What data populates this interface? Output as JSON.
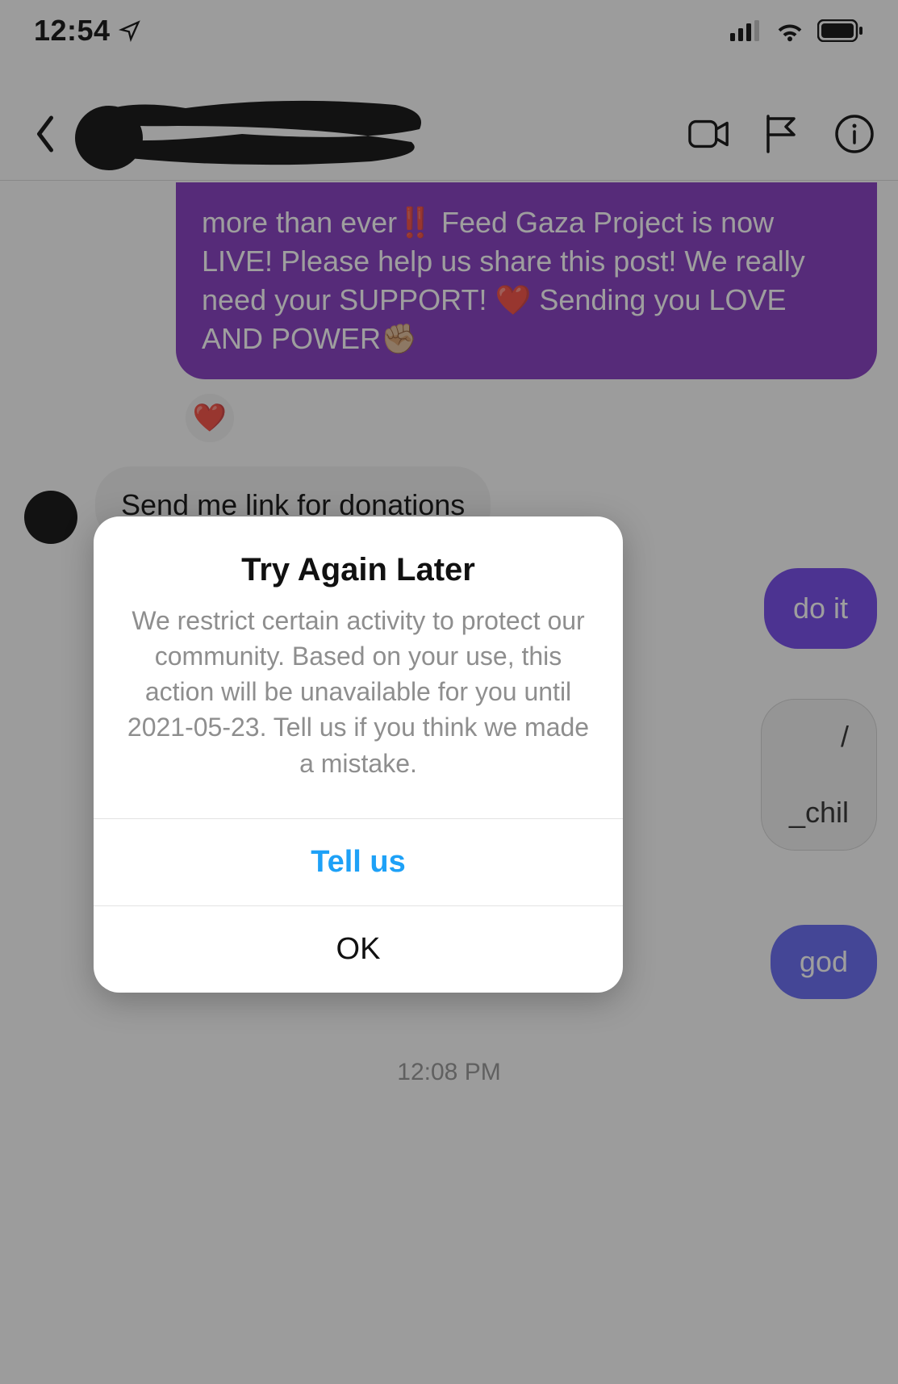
{
  "status": {
    "time": "12:54"
  },
  "chat": {
    "msg_sent_1": "more than ever‼️ Feed Gaza Project is now LIVE! Please help us share this post! We really need your SUPPORT! ❤️ Sending you LOVE AND POWER✊🏼",
    "reaction_1": "❤️",
    "msg_recv_1": "Send me link for donations",
    "msg_sent_2_fragment": "do it",
    "msg_recv_2_fragment_top": "/",
    "msg_recv_2_fragment_bot": "_chil",
    "msg_sent_3_fragment": "god",
    "timestamp": "12:08 PM"
  },
  "modal": {
    "title": "Try Again Later",
    "body": "We restrict certain activity to protect our community. Based on your use, this action will be unavailable for you until 2021-05-23. Tell us if you think we made a mistake.",
    "tell_us": "Tell us",
    "ok": "OK"
  }
}
